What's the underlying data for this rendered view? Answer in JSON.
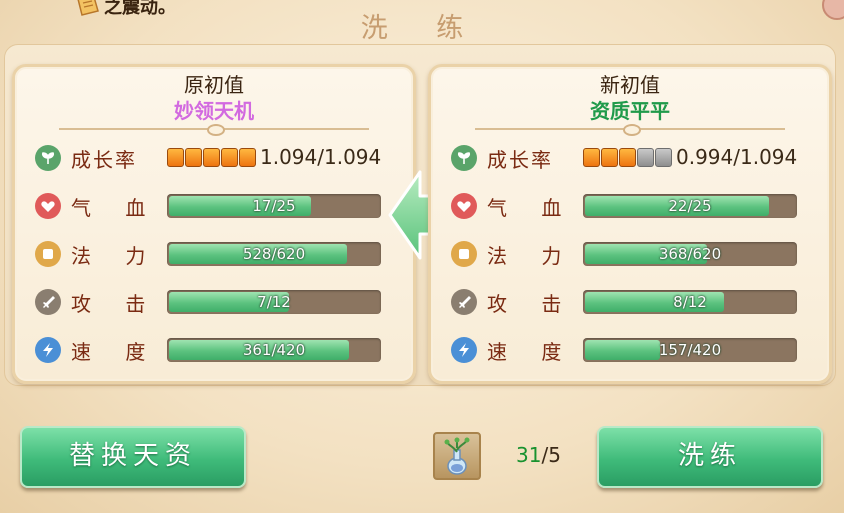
{
  "top_hint": {
    "text": "之震动。"
  },
  "title": "洗 练",
  "left_card": {
    "heading": "原初值",
    "aptitude": "妙领天机",
    "growth": {
      "label": "成长率",
      "filled": 5,
      "total": 5,
      "value_text": "1.094/1.094"
    },
    "stats": [
      {
        "label": "气 血",
        "text": "17/25",
        "fraction": 0.68,
        "icon": "heart-icon"
      },
      {
        "label": "法 力",
        "text": "528/620",
        "fraction": 0.85,
        "icon": "mana-icon"
      },
      {
        "label": "攻 击",
        "text": "7/12",
        "fraction": 0.58,
        "icon": "sword-icon"
      },
      {
        "label": "速 度",
        "text": "361/420",
        "fraction": 0.86,
        "icon": "speed-icon"
      }
    ]
  },
  "right_card": {
    "heading": "新初值",
    "aptitude": "资质平平",
    "growth": {
      "label": "成长率",
      "filled": 3,
      "total": 5,
      "value_text": "0.994/1.094"
    },
    "stats": [
      {
        "label": "气 血",
        "text": "22/25",
        "fraction": 0.88,
        "icon": "heart-icon"
      },
      {
        "label": "法 力",
        "text": "368/620",
        "fraction": 0.59,
        "icon": "mana-icon"
      },
      {
        "label": "攻 击",
        "text": "8/12",
        "fraction": 0.67,
        "icon": "sword-icon"
      },
      {
        "label": "速 度",
        "text": "157/420",
        "fraction": 0.37,
        "icon": "speed-icon"
      }
    ]
  },
  "buttons": {
    "replace": "替换天资",
    "refine": "洗练"
  },
  "item": {
    "current": "31",
    "required": "/5"
  },
  "colors": {
    "accent_green": "#3fbb7a",
    "label_red": "#7a2a12",
    "aptitude_purple": "#d26ae0",
    "aptitude_green": "#1f9a4a"
  }
}
